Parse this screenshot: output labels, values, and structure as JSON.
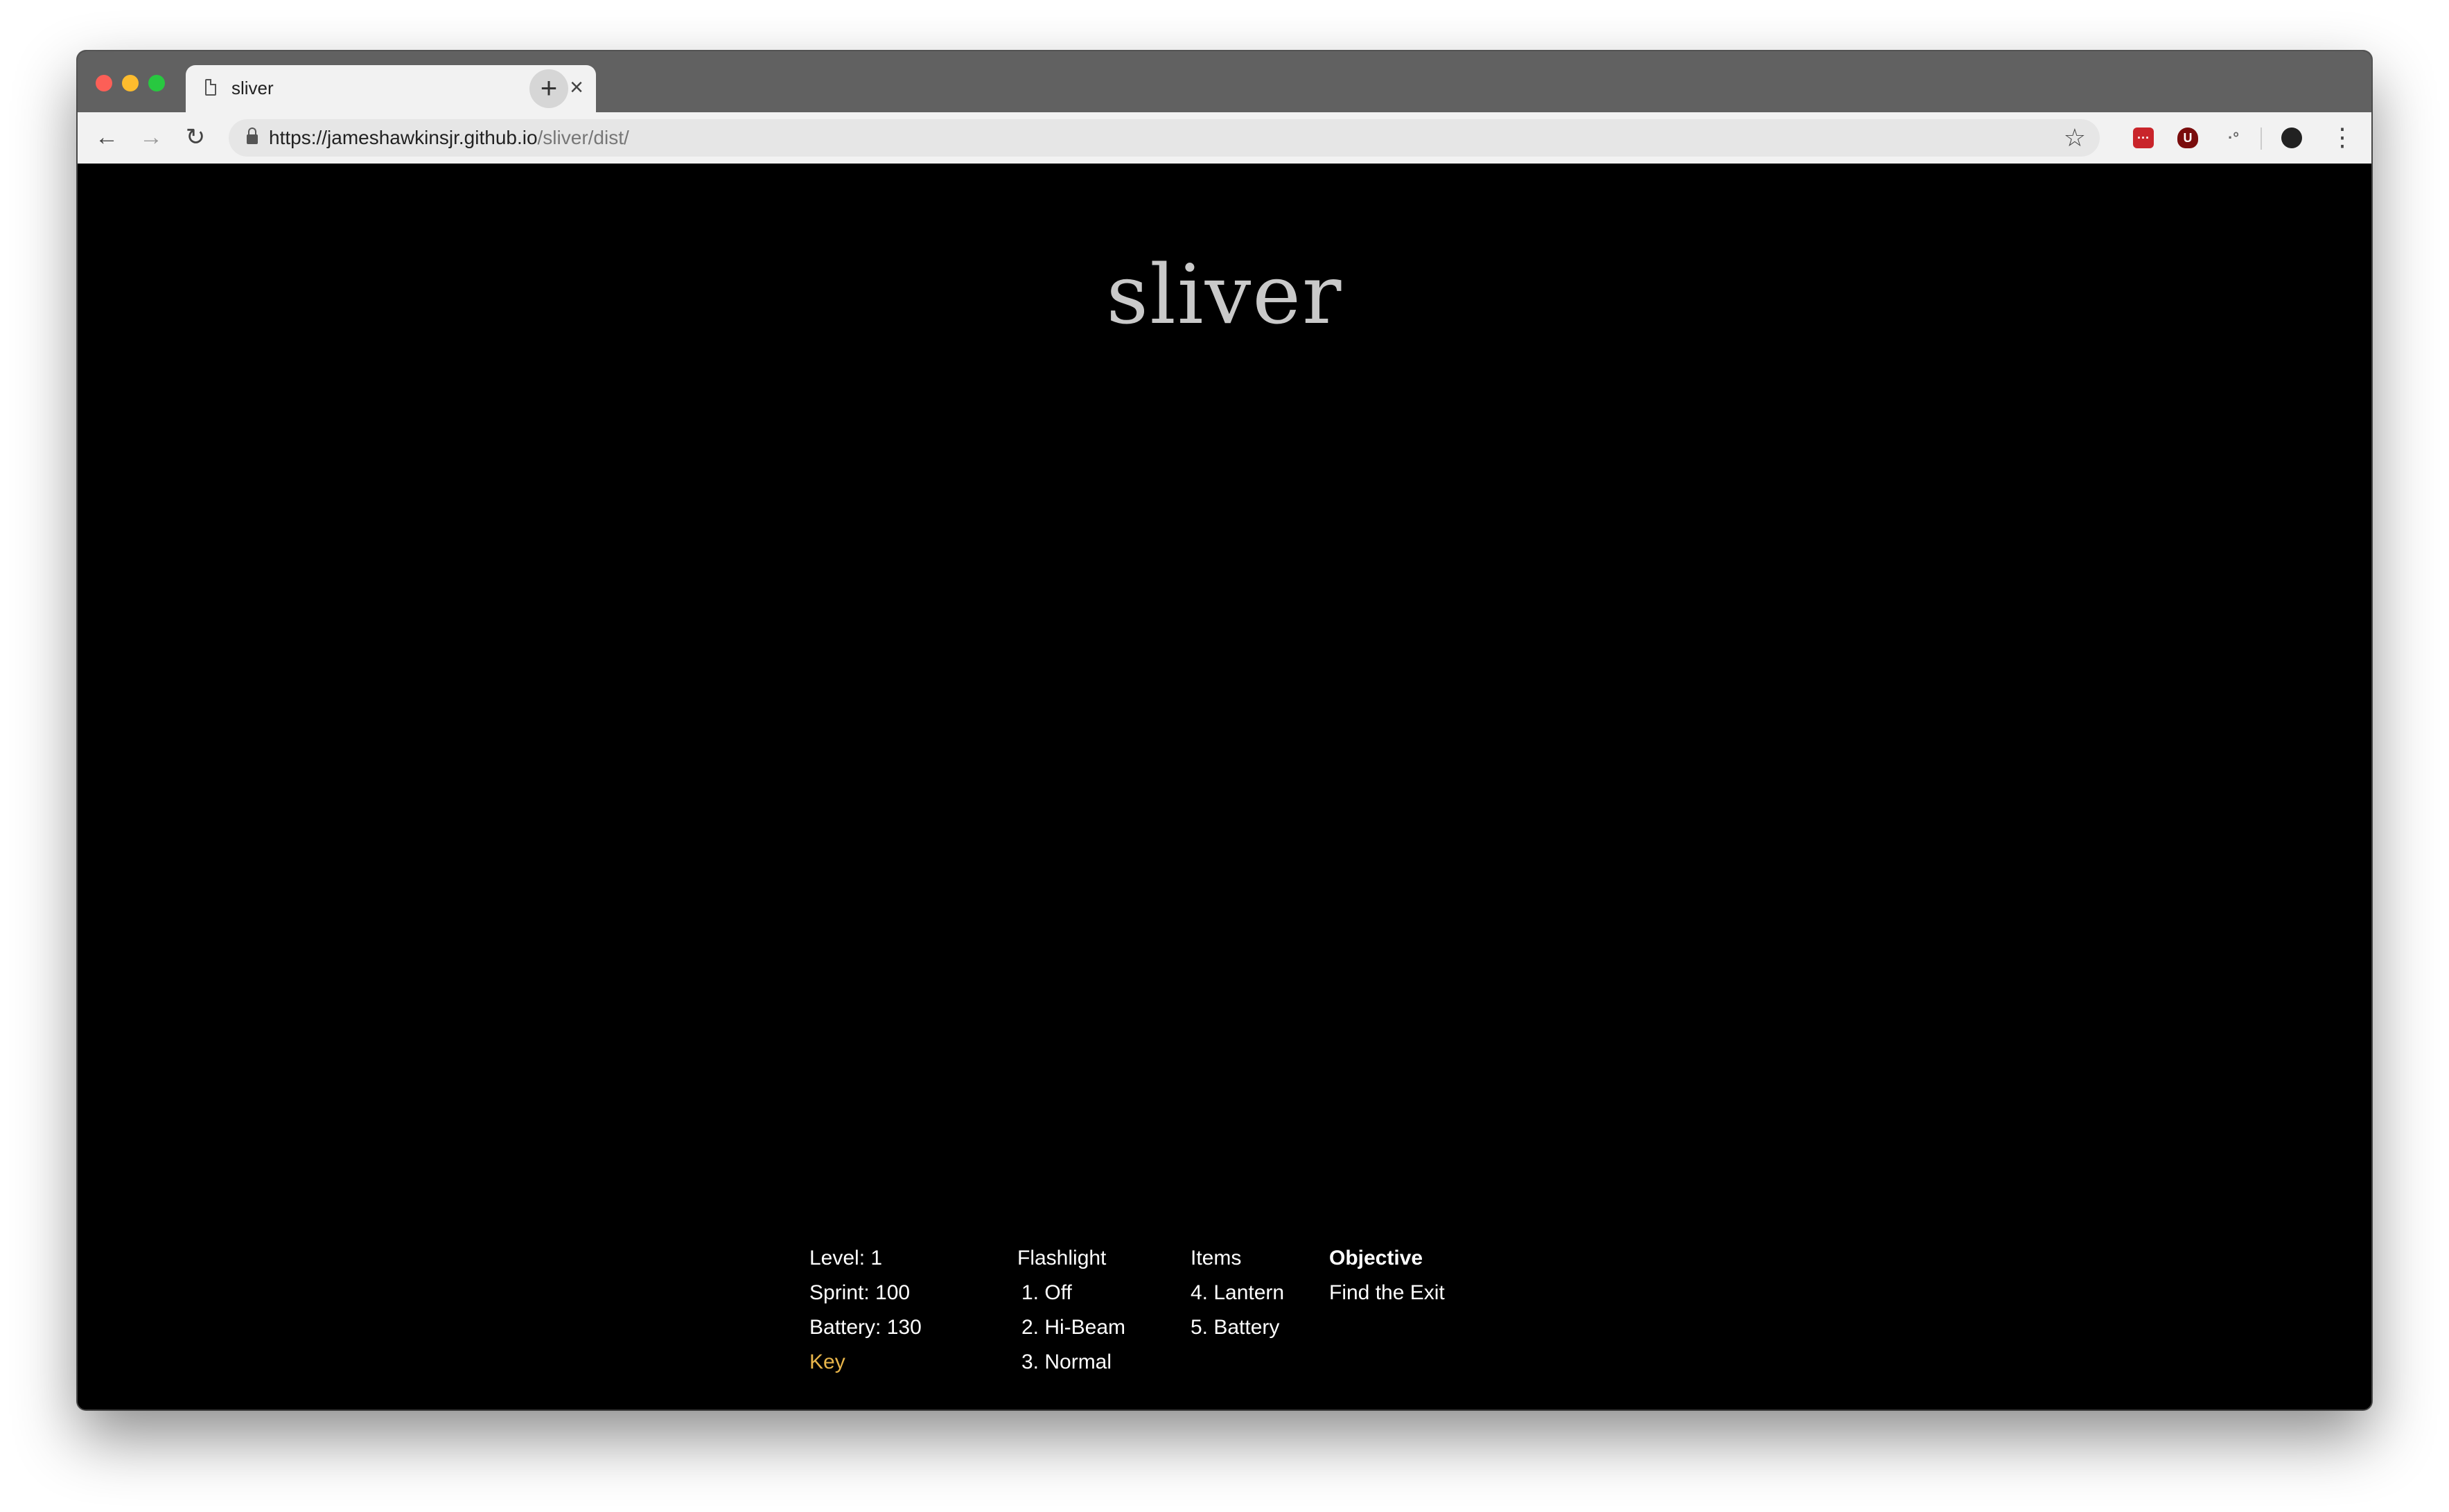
{
  "browser": {
    "tab_title": "sliver",
    "tab_close": "×",
    "new_tab": "+",
    "nav_back": "←",
    "nav_forward": "→",
    "nav_reload": "↻",
    "url_main": "https://jameshawkinsjr.github.io",
    "url_path": "/sliver/dist/",
    "star": "☆",
    "menu": "⋮"
  },
  "game": {
    "title": "sliver",
    "light_color": "#7e7a34"
  },
  "hud": {
    "status": {
      "level": "Level: 1",
      "sprint": "Sprint: 100",
      "battery": "Battery: 130",
      "key": "Key"
    },
    "flashlight": {
      "header": "Flashlight",
      "options": [
        "1. Off",
        "2. Hi-Beam",
        "3. Normal"
      ]
    },
    "items": {
      "header": "Items",
      "options": [
        "4. Lantern",
        "5. Battery"
      ]
    },
    "objective": {
      "header": "Objective",
      "text": "Find the Exit"
    }
  },
  "colors": {
    "key": "#e8b54a",
    "title": "#c9c9c9",
    "hud_text": "#ffffff"
  }
}
